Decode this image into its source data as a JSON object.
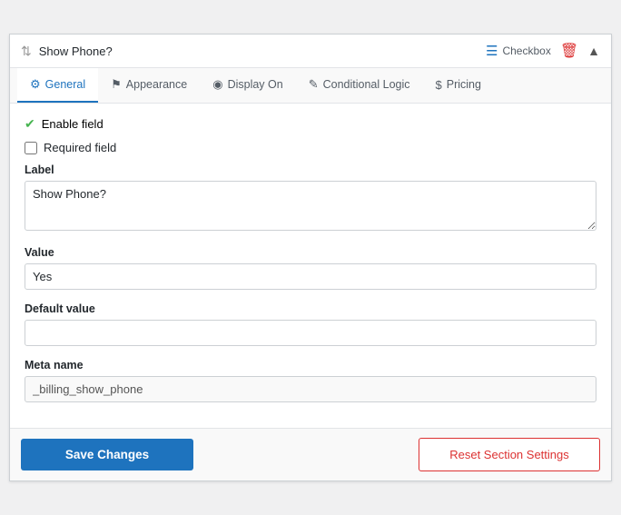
{
  "header": {
    "title": "Show Phone?",
    "field_type": "Checkbox",
    "drag_icon": "⇅",
    "list_icon": "≡",
    "delete_icon": "🗑",
    "collapse_icon": "▲"
  },
  "tabs": [
    {
      "id": "general",
      "label": "General",
      "icon": "⚙",
      "active": true
    },
    {
      "id": "appearance",
      "label": "Appearance",
      "icon": "⚑",
      "active": false
    },
    {
      "id": "display_on",
      "label": "Display On",
      "icon": "◉",
      "active": false
    },
    {
      "id": "conditional_logic",
      "label": "Conditional Logic",
      "icon": "✎",
      "active": false
    },
    {
      "id": "pricing",
      "label": "Pricing",
      "icon": "$",
      "active": false
    }
  ],
  "fields": {
    "enable_field": {
      "label": "Enable field",
      "checked": true
    },
    "required_field": {
      "label": "Required field",
      "checked": false
    },
    "label": {
      "label": "Label",
      "value": "Show Phone?"
    },
    "value": {
      "label": "Value",
      "value": "Yes"
    },
    "default_value": {
      "label": "Default value",
      "value": ""
    },
    "meta_name": {
      "label": "Meta name",
      "value": "_billing_show_phone"
    }
  },
  "footer": {
    "save_label": "Save Changes",
    "reset_label": "Reset Section Settings"
  }
}
